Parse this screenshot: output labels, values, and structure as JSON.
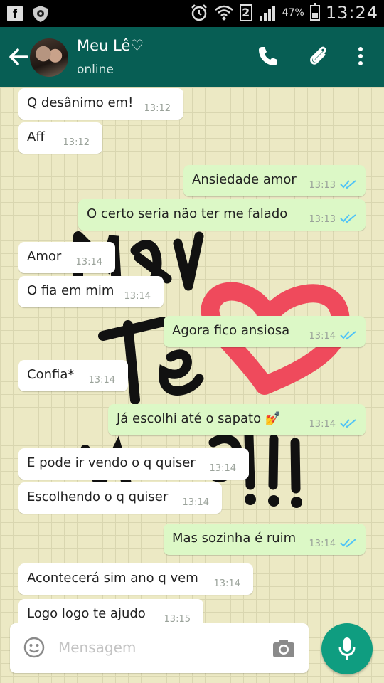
{
  "status_bar": {
    "battery_percent": "47%",
    "battery_level": 0.47,
    "time": "13:24",
    "sim_slot": "2",
    "icons": [
      "facebook-icon",
      "shield-icon",
      "alarm-icon",
      "wifi-icon",
      "signal-icon",
      "battery-icon"
    ]
  },
  "header": {
    "contact_name": "Meu Lê♡",
    "status": "online",
    "icons": [
      "back-arrow-icon",
      "avatar",
      "phone-icon",
      "paperclip-icon",
      "more-vert-icon"
    ],
    "color": "#075e54"
  },
  "messages": [
    {
      "dir": "in",
      "text": "Q desânimo em!",
      "time": "13:12"
    },
    {
      "dir": "in",
      "text": "Aff",
      "time": "13:12"
    },
    {
      "dir": "out",
      "text": "Ansiedade amor",
      "time": "13:13",
      "read": true
    },
    {
      "dir": "out",
      "text": "O certo seria não ter me falado",
      "time": "13:13",
      "read": true
    },
    {
      "dir": "in",
      "text": "Amor",
      "time": "13:14"
    },
    {
      "dir": "in",
      "text": "O fia em mim",
      "time": "13:14"
    },
    {
      "dir": "out",
      "text": "Agora fico ansiosa",
      "time": "13:14",
      "read": true
    },
    {
      "dir": "in",
      "text": "Confia*",
      "time": "13:14"
    },
    {
      "dir": "out",
      "text": "Já escolhi até o sapato 💅",
      "time": "13:14",
      "read": true
    },
    {
      "dir": "in",
      "text": "E pode ir vendo o q quiser",
      "time": "13:14"
    },
    {
      "dir": "in",
      "text": "Escolhendo o q quiser",
      "time": "13:14"
    },
    {
      "dir": "out",
      "text": "Mas sozinha é ruim",
      "time": "13:14",
      "read": true
    },
    {
      "dir": "in",
      "text": "Acontecerá sim ano q vem",
      "time": "13:14"
    },
    {
      "dir": "in",
      "text": "Logo logo te ajudo",
      "time": "13:15"
    }
  ],
  "composer": {
    "placeholder": "Mensagem",
    "icons": [
      "emoji-icon",
      "camera-icon",
      "mic-icon"
    ]
  },
  "colors": {
    "incoming_bubble": "#ffffff",
    "outgoing_bubble": "#dcf8c6",
    "read_ticks": "#4fc3f7",
    "fab": "#0f9d80",
    "doodle_heart": "#ef4a5c"
  }
}
